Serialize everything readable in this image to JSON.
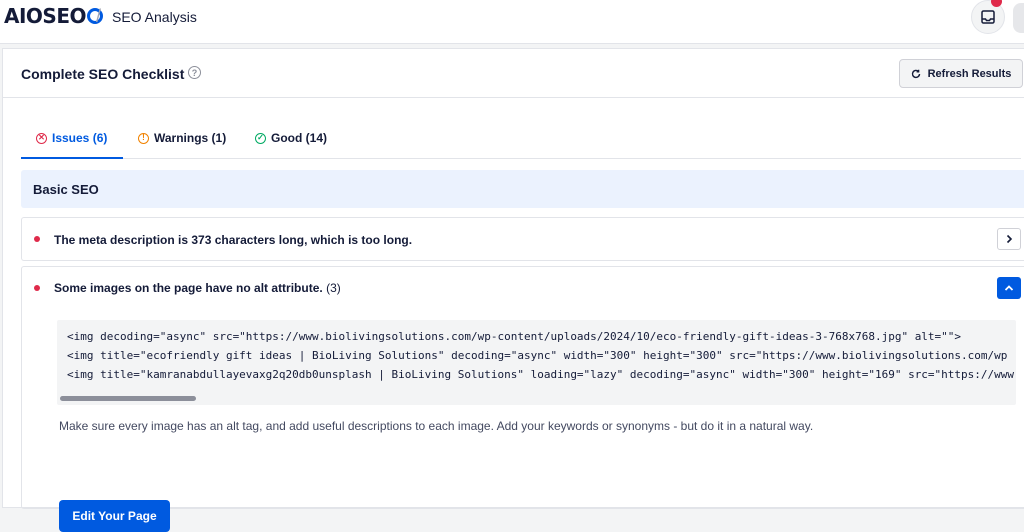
{
  "topbar": {
    "logo_prefix": "AIO",
    "logo_suffix": "EO",
    "separator": "/",
    "breadcrumb": "SEO Analysis"
  },
  "panel": {
    "title": "Complete SEO Checklist",
    "help_glyph": "?",
    "refresh_label": "Refresh Results",
    "refresh_icon": "refresh-icon"
  },
  "tabs": [
    {
      "label": "Issues (6)",
      "icon": "x-circle-icon",
      "glyph": "✕",
      "color": "#df2a4a",
      "active": true
    },
    {
      "label": "Warnings (1)",
      "icon": "info-circle-icon",
      "glyph": "!",
      "color": "#f18200",
      "active": false
    },
    {
      "label": "Good (14)",
      "icon": "check-circle-icon",
      "glyph": "✓",
      "color": "#00aa63",
      "active": false
    }
  ],
  "section": {
    "title": "Basic SEO"
  },
  "issues": [
    {
      "text": "The meta description is 373 characters long, which is too long.",
      "expanded": false
    },
    {
      "text": "Some images on the page have no alt attribute.",
      "count": "(3)",
      "expanded": true,
      "code_lines": [
        "<img decoding=\"async\" src=\"https://www.biolivingsolutions.com/wp-content/uploads/2024/10/eco-friendly-gift-ideas-3-768x768.jpg\" alt=\"\">",
        "<img title=\"ecofriendly gift ideas | BioLiving Solutions\" decoding=\"async\" width=\"300\" height=\"300\" src=\"https://www.biolivingsolutions.com/wp",
        "<img title=\"kamranabdullayevaxg2q20db0unsplash | BioLiving Solutions\" loading=\"lazy\" decoding=\"async\" width=\"300\" height=\"169\" src=\"https://www"
      ],
      "hint": "Make sure every image has an alt tag, and add useful descriptions to each image. Add your keywords or synonyms - but do it in a natural way.",
      "action_label": "Edit Your Page"
    }
  ],
  "colors": {
    "brand": "#005ae0",
    "error": "#df2a4a",
    "warning": "#f18200",
    "success": "#00aa63"
  }
}
